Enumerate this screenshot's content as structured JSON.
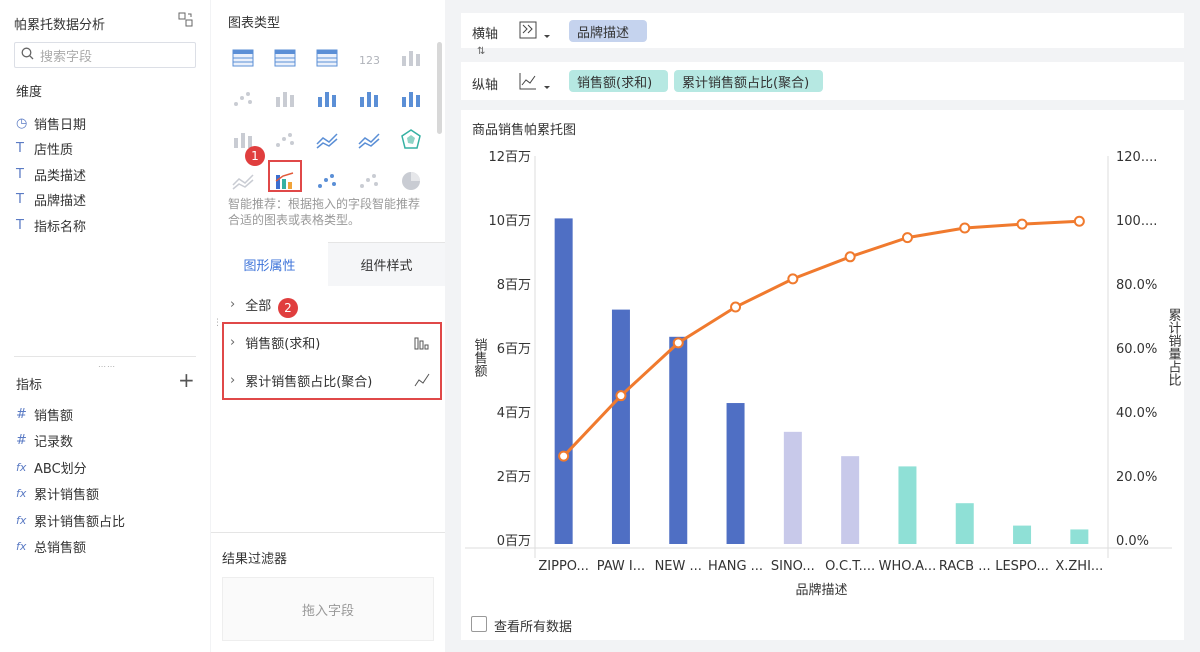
{
  "left": {
    "title": "帕累托数据分析",
    "search_placeholder": "搜索字段",
    "dimensions_title": "维度",
    "dimensions": [
      {
        "icon": "clock-icon",
        "glyph": "◷",
        "label": "销售日期"
      },
      {
        "icon": "text-type-icon",
        "glyph": "T",
        "label": "店性质"
      },
      {
        "icon": "text-type-icon",
        "glyph": "T",
        "label": "品类描述"
      },
      {
        "icon": "text-type-icon",
        "glyph": "T",
        "label": "品牌描述"
      },
      {
        "icon": "text-type-icon",
        "glyph": "T",
        "label": "指标名称"
      }
    ],
    "metrics_title": "指标",
    "add_label": "+",
    "metrics": [
      {
        "icon": "number-icon",
        "glyph": "#",
        "label": "销售额"
      },
      {
        "icon": "number-icon",
        "glyph": "#",
        "label": "记录数"
      },
      {
        "icon": "formula-icon",
        "glyph": "fx",
        "label": "ABC划分"
      },
      {
        "icon": "formula-icon",
        "glyph": "fx",
        "label": "累计销售额"
      },
      {
        "icon": "formula-icon",
        "glyph": "fx",
        "label": "累计销售额占比"
      },
      {
        "icon": "formula-icon",
        "glyph": "fx",
        "label": "总销售额"
      }
    ]
  },
  "mid": {
    "chart_type_title": "图表类型",
    "hint": "智能推荐：根据拖入的字段智能推荐合适的图表或表格类型。",
    "tab_graph": "图形属性",
    "tab_style": "组件样式",
    "rows": [
      {
        "label": "全部"
      },
      {
        "label": "销售额(求和)"
      },
      {
        "label": "累计销售额占比(聚合)"
      }
    ],
    "badge1": "1",
    "badge2": "2",
    "filter_title": "结果过滤器",
    "filter_drop": "拖入字段"
  },
  "right": {
    "x_axis_label": "横轴",
    "y_axis_label": "纵轴",
    "x_chips": [
      "品牌描述"
    ],
    "y_chips": [
      "销售额(求和)",
      "累计销售额占比(聚合)"
    ],
    "chart_title": "商品销售帕累托图",
    "view_all": "查看所有数据",
    "colors": {
      "bar_dark": "#4f6fc4",
      "bar_light": "#c8c9ea",
      "bar_teal": "#8fe0d6",
      "line": "#f07a2e",
      "chip_blue": "#c5d3ee",
      "chip_teal": "#b6e8e2"
    }
  },
  "chart_data": {
    "type": "bar",
    "title": "商品销售帕累托图",
    "xlabel": "品牌描述",
    "ylabel": "销售额",
    "y2label": "累计销量占比",
    "categories": [
      "ZIPPO...",
      "PAW I...",
      "NEW ...",
      "HANG ...",
      "SINO...",
      "O.C.T....",
      "WHO.A...",
      "RACB ...",
      "LESPO...",
      "X.ZHI..."
    ],
    "yticks": [
      "0百万",
      "2百万",
      "4百万",
      "6百万",
      "8百万",
      "10百万",
      "12百万"
    ],
    "y2ticks": [
      "0.0%",
      "20.0%",
      "40.0%",
      "60.0%",
      "80.0%",
      "100....",
      "120...."
    ],
    "ylim": [
      0,
      12000000
    ],
    "y2lim": [
      0,
      120
    ],
    "series": [
      {
        "name": "销售额(求和)",
        "type": "bar",
        "values": [
          10050000,
          7200000,
          6350000,
          4280000,
          3380000,
          2620000,
          2300000,
          1150000,
          450000,
          330000
        ],
        "groups": [
          "A",
          "A",
          "A",
          "A",
          "B",
          "B",
          "C",
          "C",
          "C",
          "C"
        ]
      },
      {
        "name": "累计销售额占比(聚合)",
        "type": "line",
        "values": [
          26.2,
          45.1,
          61.6,
          72.8,
          81.6,
          88.5,
          94.5,
          97.5,
          98.7,
          99.6
        ]
      }
    ]
  }
}
